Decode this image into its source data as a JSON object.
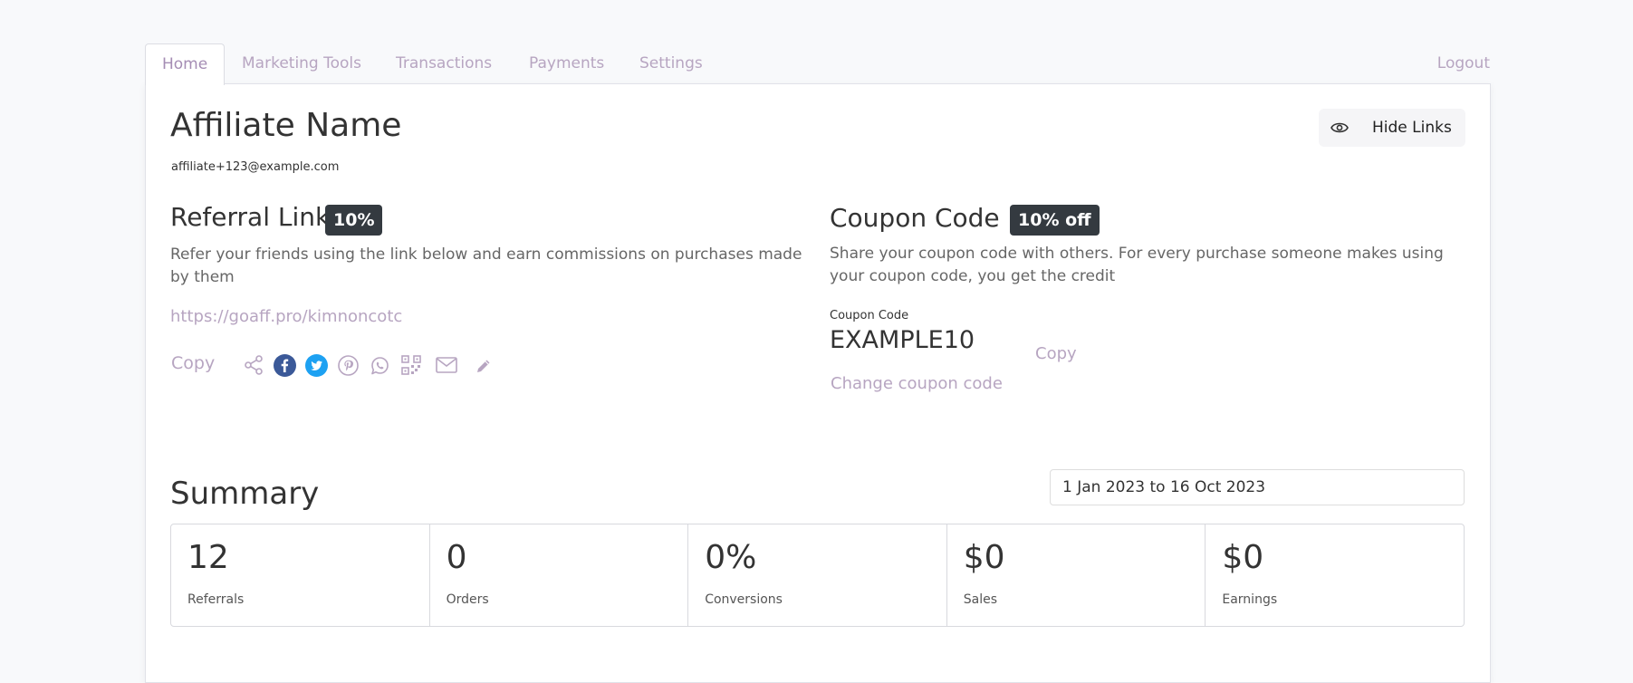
{
  "nav": {
    "tabs": [
      {
        "label": "Home",
        "active": true
      },
      {
        "label": "Marketing Tools",
        "active": false
      },
      {
        "label": "Transactions",
        "active": false
      },
      {
        "label": "Payments",
        "active": false
      },
      {
        "label": "Settings",
        "active": false
      }
    ],
    "logout_label": "Logout"
  },
  "affiliate": {
    "name": "Affiliate Name",
    "email": "affiliate+123@example.com"
  },
  "hide_links": {
    "label": "Hide Links",
    "icon": "eye-icon"
  },
  "referral": {
    "title": "Referral Link",
    "badge": "10%",
    "description": "Refer your friends using the link below and earn commissions on purchases made by them",
    "link": "https://goaff.pro/kimnoncotc",
    "copy_label": "Copy",
    "share_icons": [
      "share-icon",
      "facebook-icon",
      "twitter-icon",
      "pinterest-icon",
      "whatsapp-icon",
      "qr-code-icon",
      "email-icon",
      "edit-icon"
    ]
  },
  "coupon": {
    "title": "Coupon Code",
    "badge": "10% off",
    "description": "Share your coupon code with others. For every purchase someone makes using your coupon code, you get the credit",
    "field_label": "Coupon Code",
    "code": "EXAMPLE10",
    "copy_label": "Copy",
    "change_label": "Change coupon code"
  },
  "summary": {
    "title": "Summary",
    "date_range": "1 Jan 2023 to 16 Oct 2023",
    "stats": [
      {
        "value": "12",
        "label": "Referrals"
      },
      {
        "value": "0",
        "label": "Orders"
      },
      {
        "value": "0%",
        "label": "Conversions"
      },
      {
        "value": "$0",
        "label": "Sales"
      },
      {
        "value": "$0",
        "label": "Earnings"
      }
    ]
  },
  "colors": {
    "accent": "#b7a5c1",
    "badge_bg": "#343a40",
    "facebook": "#3b5998",
    "twitter": "#1da1f2"
  }
}
